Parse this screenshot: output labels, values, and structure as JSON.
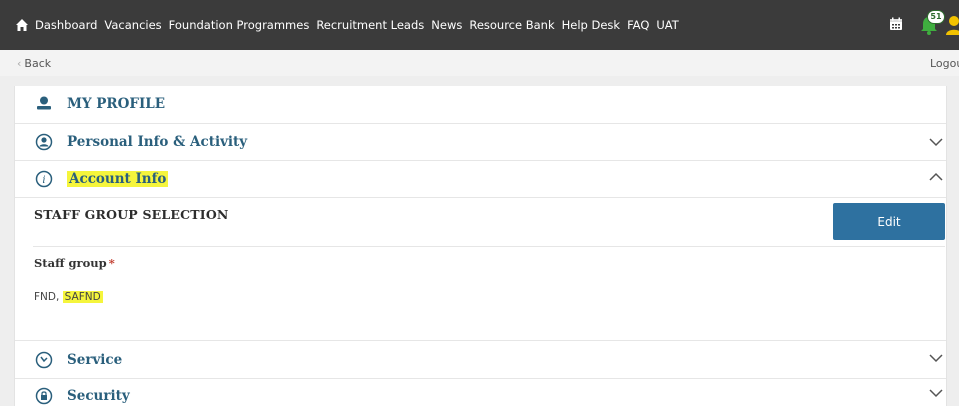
{
  "nav": {
    "items": [
      "Dashboard",
      "Vacancies",
      "Foundation Programmes",
      "Recruitment Leads",
      "News",
      "Resource Bank",
      "Help Desk",
      "FAQ",
      "UAT"
    ],
    "notification_count": "51"
  },
  "subbar": {
    "back_label": "Back",
    "logout_label": "Logout"
  },
  "profile": {
    "header": "MY PROFILE",
    "sections": {
      "personal": "Personal Info & Activity",
      "account": "Account Info",
      "service": "Service",
      "security": "Security"
    },
    "account_info": {
      "section_title": "STAFF GROUP SELECTION",
      "edit_label": "Edit",
      "field_label": "Staff group",
      "required_mark": "*",
      "value_prefix": "FND, ",
      "value_highlighted": "SAFND"
    }
  },
  "colors": {
    "nav_bg": "#3b3b3b",
    "title_blue": "#2a5f7c",
    "button_blue": "#2e71a0",
    "highlight": "#f5f53c",
    "bell_green": "#3fae3f",
    "user_yellow": "#f2c200"
  },
  "icons": [
    "home-icon",
    "calendar-icon",
    "bell-icon",
    "user-icon",
    "person-icon",
    "person-circle-icon",
    "info-icon",
    "service-icon",
    "lock-icon",
    "chevron-down-icon",
    "chevron-up-icon"
  ]
}
